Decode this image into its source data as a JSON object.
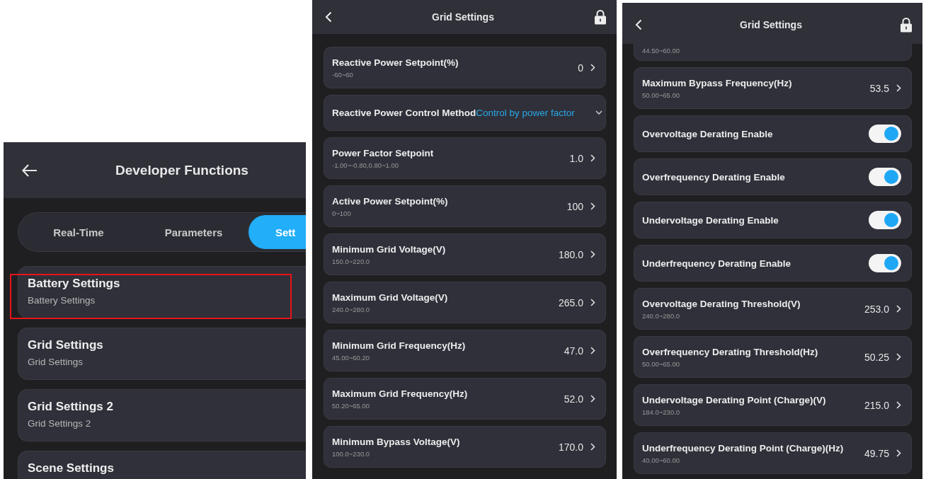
{
  "panels": [
    {
      "kind": "menu",
      "title": "Developer Functions",
      "tabs": [
        {
          "label": "Real-Time",
          "selected": false
        },
        {
          "label": "Parameters",
          "selected": false
        },
        {
          "label": "Sett",
          "selected": true
        }
      ],
      "items": [
        {
          "title": "Battery Settings",
          "subtitle": "Battery Settings",
          "highlighted": true
        },
        {
          "title": "Grid Settings",
          "subtitle": "Grid Settings",
          "highlighted": false
        },
        {
          "title": "Grid Settings 2",
          "subtitle": "Grid Settings 2",
          "highlighted": false
        },
        {
          "title": "Scene Settings",
          "highlighted": false
        }
      ]
    },
    {
      "kind": "list",
      "title": "Grid Settings",
      "rows": [
        {
          "kind": "value",
          "label": "Reactive Power Setpoint(%)",
          "range": "-60~60",
          "value": "0"
        },
        {
          "kind": "select",
          "label": "Reactive Power Control Method",
          "value": "Control by power factor"
        },
        {
          "kind": "value",
          "label": "Power Factor Setpoint",
          "range": "-1.00~-0.80,0.80~1.00",
          "value": "1.0"
        },
        {
          "kind": "value",
          "label": "Active Power Setpoint(%)",
          "range": "0~100",
          "value": "100"
        },
        {
          "kind": "value",
          "label": "Minimum Grid Voltage(V)",
          "range": "150.0~220.0",
          "value": "180.0"
        },
        {
          "kind": "value",
          "label": "Maximum Grid Voltage(V)",
          "range": "240.0~280.0",
          "value": "265.0"
        },
        {
          "kind": "value",
          "label": "Minimum Grid Frequency(Hz)",
          "range": "45.00~60.20",
          "value": "47.0"
        },
        {
          "kind": "value",
          "label": "Maximum Grid Frequency(Hz)",
          "range": "50.20~65.00",
          "value": "52.0"
        },
        {
          "kind": "value",
          "label": "Minimum Bypass Voltage(V)",
          "range": "100.0~230.0",
          "value": "170.0"
        }
      ]
    },
    {
      "kind": "list",
      "title": "Grid Settings",
      "rows": [
        {
          "kind": "partial",
          "range": "44.50~60.00"
        },
        {
          "kind": "value",
          "label": "Maximum Bypass Frequency(Hz)",
          "range": "50.00~65.00",
          "value": "53.5"
        },
        {
          "kind": "toggle",
          "label": "Overvoltage Derating Enable",
          "on": true
        },
        {
          "kind": "toggle",
          "label": "Overfrequency Derating Enable",
          "on": true
        },
        {
          "kind": "toggle",
          "label": "Undervoltage Derating Enable",
          "on": true
        },
        {
          "kind": "toggle",
          "label": "Underfrequency Derating Enable",
          "on": true
        },
        {
          "kind": "value",
          "label": "Overvoltage Derating Threshold(V)",
          "range": "240.0~280.0",
          "value": "253.0"
        },
        {
          "kind": "value",
          "label": "Overfrequency Derating Threshold(Hz)",
          "range": "50.00~65.00",
          "value": "50.25"
        },
        {
          "kind": "value",
          "label": "Undervoltage Derating Point (Charge)(V)",
          "range": "184.0~230.0",
          "value": "215.0"
        },
        {
          "kind": "value",
          "label": "Underfrequency Derating Point (Charge)(Hz)",
          "range": "40.00~60.00",
          "value": "49.75"
        }
      ]
    }
  ]
}
